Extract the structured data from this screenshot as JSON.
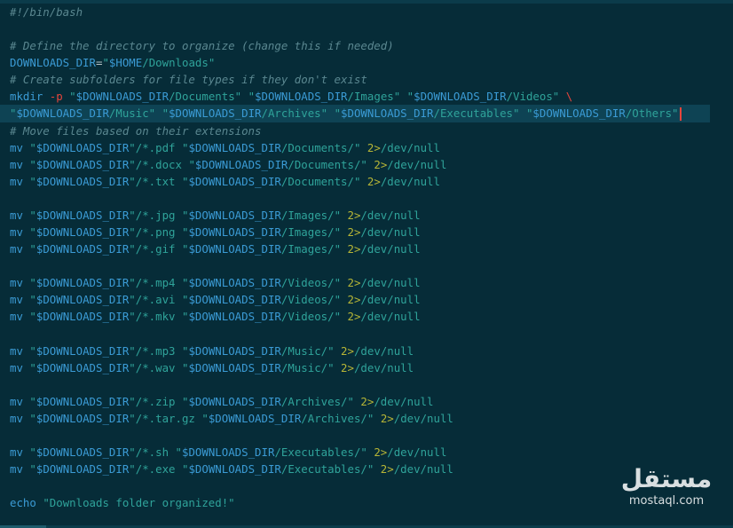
{
  "editor": {
    "lines": [
      {
        "tokens": [
          {
            "t": "comment",
            "v": "#!/bin/bash"
          }
        ]
      },
      {
        "tokens": []
      },
      {
        "tokens": [
          {
            "t": "comment",
            "v": "# Define the directory to organize (change this if needed)"
          }
        ]
      },
      {
        "tokens": [
          {
            "t": "var",
            "v": "DOWNLOADS_DIR"
          },
          {
            "t": "plain",
            "v": "="
          },
          {
            "t": "string",
            "v": "\""
          },
          {
            "t": "var",
            "v": "$HOME"
          },
          {
            "t": "string",
            "v": "/Downloads\""
          }
        ]
      },
      {
        "tokens": [
          {
            "t": "comment",
            "v": "# Create subfolders for file types if they don't exist"
          }
        ]
      },
      {
        "tokens": [
          {
            "t": "cmd",
            "v": "mkdir"
          },
          {
            "t": "plain",
            "v": " "
          },
          {
            "t": "keyword",
            "v": "-p"
          },
          {
            "t": "plain",
            "v": " "
          },
          {
            "t": "string",
            "v": "\""
          },
          {
            "t": "var",
            "v": "$DOWNLOADS_DIR"
          },
          {
            "t": "string",
            "v": "/Documents\""
          },
          {
            "t": "plain",
            "v": " "
          },
          {
            "t": "string",
            "v": "\""
          },
          {
            "t": "var",
            "v": "$DOWNLOADS_DIR"
          },
          {
            "t": "string",
            "v": "/Images\""
          },
          {
            "t": "plain",
            "v": " "
          },
          {
            "t": "string",
            "v": "\""
          },
          {
            "t": "var",
            "v": "$DOWNLOADS_DIR"
          },
          {
            "t": "string",
            "v": "/Videos\""
          },
          {
            "t": "plain",
            "v": " "
          },
          {
            "t": "keyword",
            "v": "\\"
          }
        ]
      },
      {
        "active": true,
        "cursor": true,
        "tokens": [
          {
            "t": "string",
            "v": "\""
          },
          {
            "t": "var",
            "v": "$DOWNLOADS_DIR"
          },
          {
            "t": "string",
            "v": "/Music\""
          },
          {
            "t": "plain",
            "v": " "
          },
          {
            "t": "string",
            "v": "\""
          },
          {
            "t": "var",
            "v": "$DOWNLOADS_DIR"
          },
          {
            "t": "string",
            "v": "/Archives\""
          },
          {
            "t": "plain",
            "v": " "
          },
          {
            "t": "string",
            "v": "\""
          },
          {
            "t": "var",
            "v": "$DOWNLOADS_DIR"
          },
          {
            "t": "string",
            "v": "/Executables\""
          },
          {
            "t": "plain",
            "v": " "
          },
          {
            "t": "string",
            "v": "\""
          },
          {
            "t": "var",
            "v": "$DOWNLOADS_DIR"
          },
          {
            "t": "string",
            "v": "/Others\""
          }
        ]
      },
      {
        "tokens": [
          {
            "t": "comment",
            "v": "# Move files based on their extensions"
          }
        ]
      },
      {
        "tokens": [
          {
            "t": "cmd",
            "v": "mv"
          },
          {
            "t": "plain",
            "v": " "
          },
          {
            "t": "string",
            "v": "\""
          },
          {
            "t": "var",
            "v": "$DOWNLOADS_DIR"
          },
          {
            "t": "string",
            "v": "\"/*.pdf"
          },
          {
            "t": "plain",
            "v": " "
          },
          {
            "t": "string",
            "v": "\""
          },
          {
            "t": "var",
            "v": "$DOWNLOADS_DIR"
          },
          {
            "t": "string",
            "v": "/Documents/\""
          },
          {
            "t": "plain",
            "v": " "
          },
          {
            "t": "redirect",
            "v": "2>"
          },
          {
            "t": "string",
            "v": "/dev/null"
          }
        ]
      },
      {
        "tokens": [
          {
            "t": "cmd",
            "v": "mv"
          },
          {
            "t": "plain",
            "v": " "
          },
          {
            "t": "string",
            "v": "\""
          },
          {
            "t": "var",
            "v": "$DOWNLOADS_DIR"
          },
          {
            "t": "string",
            "v": "\"/*.docx"
          },
          {
            "t": "plain",
            "v": " "
          },
          {
            "t": "string",
            "v": "\""
          },
          {
            "t": "var",
            "v": "$DOWNLOADS_DIR"
          },
          {
            "t": "string",
            "v": "/Documents/\""
          },
          {
            "t": "plain",
            "v": " "
          },
          {
            "t": "redirect",
            "v": "2>"
          },
          {
            "t": "string",
            "v": "/dev/null"
          }
        ]
      },
      {
        "tokens": [
          {
            "t": "cmd",
            "v": "mv"
          },
          {
            "t": "plain",
            "v": " "
          },
          {
            "t": "string",
            "v": "\""
          },
          {
            "t": "var",
            "v": "$DOWNLOADS_DIR"
          },
          {
            "t": "string",
            "v": "\"/*.txt"
          },
          {
            "t": "plain",
            "v": " "
          },
          {
            "t": "string",
            "v": "\""
          },
          {
            "t": "var",
            "v": "$DOWNLOADS_DIR"
          },
          {
            "t": "string",
            "v": "/Documents/\""
          },
          {
            "t": "plain",
            "v": " "
          },
          {
            "t": "redirect",
            "v": "2>"
          },
          {
            "t": "string",
            "v": "/dev/null"
          }
        ]
      },
      {
        "tokens": []
      },
      {
        "tokens": [
          {
            "t": "cmd",
            "v": "mv"
          },
          {
            "t": "plain",
            "v": " "
          },
          {
            "t": "string",
            "v": "\""
          },
          {
            "t": "var",
            "v": "$DOWNLOADS_DIR"
          },
          {
            "t": "string",
            "v": "\"/*.jpg"
          },
          {
            "t": "plain",
            "v": " "
          },
          {
            "t": "string",
            "v": "\""
          },
          {
            "t": "var",
            "v": "$DOWNLOADS_DIR"
          },
          {
            "t": "string",
            "v": "/Images/\""
          },
          {
            "t": "plain",
            "v": " "
          },
          {
            "t": "redirect",
            "v": "2>"
          },
          {
            "t": "string",
            "v": "/dev/null"
          }
        ]
      },
      {
        "tokens": [
          {
            "t": "cmd",
            "v": "mv"
          },
          {
            "t": "plain",
            "v": " "
          },
          {
            "t": "string",
            "v": "\""
          },
          {
            "t": "var",
            "v": "$DOWNLOADS_DIR"
          },
          {
            "t": "string",
            "v": "\"/*.png"
          },
          {
            "t": "plain",
            "v": " "
          },
          {
            "t": "string",
            "v": "\""
          },
          {
            "t": "var",
            "v": "$DOWNLOADS_DIR"
          },
          {
            "t": "string",
            "v": "/Images/\""
          },
          {
            "t": "plain",
            "v": " "
          },
          {
            "t": "redirect",
            "v": "2>"
          },
          {
            "t": "string",
            "v": "/dev/null"
          }
        ]
      },
      {
        "tokens": [
          {
            "t": "cmd",
            "v": "mv"
          },
          {
            "t": "plain",
            "v": " "
          },
          {
            "t": "string",
            "v": "\""
          },
          {
            "t": "var",
            "v": "$DOWNLOADS_DIR"
          },
          {
            "t": "string",
            "v": "\"/*.gif"
          },
          {
            "t": "plain",
            "v": " "
          },
          {
            "t": "string",
            "v": "\""
          },
          {
            "t": "var",
            "v": "$DOWNLOADS_DIR"
          },
          {
            "t": "string",
            "v": "/Images/\""
          },
          {
            "t": "plain",
            "v": " "
          },
          {
            "t": "redirect",
            "v": "2>"
          },
          {
            "t": "string",
            "v": "/dev/null"
          }
        ]
      },
      {
        "tokens": []
      },
      {
        "tokens": [
          {
            "t": "cmd",
            "v": "mv"
          },
          {
            "t": "plain",
            "v": " "
          },
          {
            "t": "string",
            "v": "\""
          },
          {
            "t": "var",
            "v": "$DOWNLOADS_DIR"
          },
          {
            "t": "string",
            "v": "\"/*.mp4"
          },
          {
            "t": "plain",
            "v": " "
          },
          {
            "t": "string",
            "v": "\""
          },
          {
            "t": "var",
            "v": "$DOWNLOADS_DIR"
          },
          {
            "t": "string",
            "v": "/Videos/\""
          },
          {
            "t": "plain",
            "v": " "
          },
          {
            "t": "redirect",
            "v": "2>"
          },
          {
            "t": "string",
            "v": "/dev/null"
          }
        ]
      },
      {
        "tokens": [
          {
            "t": "cmd",
            "v": "mv"
          },
          {
            "t": "plain",
            "v": " "
          },
          {
            "t": "string",
            "v": "\""
          },
          {
            "t": "var",
            "v": "$DOWNLOADS_DIR"
          },
          {
            "t": "string",
            "v": "\"/*.avi"
          },
          {
            "t": "plain",
            "v": " "
          },
          {
            "t": "string",
            "v": "\""
          },
          {
            "t": "var",
            "v": "$DOWNLOADS_DIR"
          },
          {
            "t": "string",
            "v": "/Videos/\""
          },
          {
            "t": "plain",
            "v": " "
          },
          {
            "t": "redirect",
            "v": "2>"
          },
          {
            "t": "string",
            "v": "/dev/null"
          }
        ]
      },
      {
        "tokens": [
          {
            "t": "cmd",
            "v": "mv"
          },
          {
            "t": "plain",
            "v": " "
          },
          {
            "t": "string",
            "v": "\""
          },
          {
            "t": "var",
            "v": "$DOWNLOADS_DIR"
          },
          {
            "t": "string",
            "v": "\"/*.mkv"
          },
          {
            "t": "plain",
            "v": " "
          },
          {
            "t": "string",
            "v": "\""
          },
          {
            "t": "var",
            "v": "$DOWNLOADS_DIR"
          },
          {
            "t": "string",
            "v": "/Videos/\""
          },
          {
            "t": "plain",
            "v": " "
          },
          {
            "t": "redirect",
            "v": "2>"
          },
          {
            "t": "string",
            "v": "/dev/null"
          }
        ]
      },
      {
        "tokens": []
      },
      {
        "tokens": [
          {
            "t": "cmd",
            "v": "mv"
          },
          {
            "t": "plain",
            "v": " "
          },
          {
            "t": "string",
            "v": "\""
          },
          {
            "t": "var",
            "v": "$DOWNLOADS_DIR"
          },
          {
            "t": "string",
            "v": "\"/*.mp3"
          },
          {
            "t": "plain",
            "v": " "
          },
          {
            "t": "string",
            "v": "\""
          },
          {
            "t": "var",
            "v": "$DOWNLOADS_DIR"
          },
          {
            "t": "string",
            "v": "/Music/\""
          },
          {
            "t": "plain",
            "v": " "
          },
          {
            "t": "redirect",
            "v": "2>"
          },
          {
            "t": "string",
            "v": "/dev/null"
          }
        ]
      },
      {
        "tokens": [
          {
            "t": "cmd",
            "v": "mv"
          },
          {
            "t": "plain",
            "v": " "
          },
          {
            "t": "string",
            "v": "\""
          },
          {
            "t": "var",
            "v": "$DOWNLOADS_DIR"
          },
          {
            "t": "string",
            "v": "\"/*.wav"
          },
          {
            "t": "plain",
            "v": " "
          },
          {
            "t": "string",
            "v": "\""
          },
          {
            "t": "var",
            "v": "$DOWNLOADS_DIR"
          },
          {
            "t": "string",
            "v": "/Music/\""
          },
          {
            "t": "plain",
            "v": " "
          },
          {
            "t": "redirect",
            "v": "2>"
          },
          {
            "t": "string",
            "v": "/dev/null"
          }
        ]
      },
      {
        "tokens": []
      },
      {
        "tokens": [
          {
            "t": "cmd",
            "v": "mv"
          },
          {
            "t": "plain",
            "v": " "
          },
          {
            "t": "string",
            "v": "\""
          },
          {
            "t": "var",
            "v": "$DOWNLOADS_DIR"
          },
          {
            "t": "string",
            "v": "\"/*.zip"
          },
          {
            "t": "plain",
            "v": " "
          },
          {
            "t": "string",
            "v": "\""
          },
          {
            "t": "var",
            "v": "$DOWNLOADS_DIR"
          },
          {
            "t": "string",
            "v": "/Archives/\""
          },
          {
            "t": "plain",
            "v": " "
          },
          {
            "t": "redirect",
            "v": "2>"
          },
          {
            "t": "string",
            "v": "/dev/null"
          }
        ]
      },
      {
        "tokens": [
          {
            "t": "cmd",
            "v": "mv"
          },
          {
            "t": "plain",
            "v": " "
          },
          {
            "t": "string",
            "v": "\""
          },
          {
            "t": "var",
            "v": "$DOWNLOADS_DIR"
          },
          {
            "t": "string",
            "v": "\"/*.tar.gz"
          },
          {
            "t": "plain",
            "v": " "
          },
          {
            "t": "string",
            "v": "\""
          },
          {
            "t": "var",
            "v": "$DOWNLOADS_DIR"
          },
          {
            "t": "string",
            "v": "/Archives/\""
          },
          {
            "t": "plain",
            "v": " "
          },
          {
            "t": "redirect",
            "v": "2>"
          },
          {
            "t": "string",
            "v": "/dev/null"
          }
        ]
      },
      {
        "tokens": []
      },
      {
        "tokens": [
          {
            "t": "cmd",
            "v": "mv"
          },
          {
            "t": "plain",
            "v": " "
          },
          {
            "t": "string",
            "v": "\""
          },
          {
            "t": "var",
            "v": "$DOWNLOADS_DIR"
          },
          {
            "t": "string",
            "v": "\"/*.sh"
          },
          {
            "t": "plain",
            "v": " "
          },
          {
            "t": "string",
            "v": "\""
          },
          {
            "t": "var",
            "v": "$DOWNLOADS_DIR"
          },
          {
            "t": "string",
            "v": "/Executables/\""
          },
          {
            "t": "plain",
            "v": " "
          },
          {
            "t": "redirect",
            "v": "2>"
          },
          {
            "t": "string",
            "v": "/dev/null"
          }
        ]
      },
      {
        "tokens": [
          {
            "t": "cmd",
            "v": "mv"
          },
          {
            "t": "plain",
            "v": " "
          },
          {
            "t": "string",
            "v": "\""
          },
          {
            "t": "var",
            "v": "$DOWNLOADS_DIR"
          },
          {
            "t": "string",
            "v": "\"/*.exe"
          },
          {
            "t": "plain",
            "v": " "
          },
          {
            "t": "string",
            "v": "\""
          },
          {
            "t": "var",
            "v": "$DOWNLOADS_DIR"
          },
          {
            "t": "string",
            "v": "/Executables/\""
          },
          {
            "t": "plain",
            "v": " "
          },
          {
            "t": "redirect",
            "v": "2>"
          },
          {
            "t": "string",
            "v": "/dev/null"
          }
        ]
      },
      {
        "tokens": []
      },
      {
        "tokens": [
          {
            "t": "cmd",
            "v": "echo"
          },
          {
            "t": "plain",
            "v": " "
          },
          {
            "t": "string",
            "v": "\"Downloads folder organized!\""
          }
        ]
      }
    ]
  },
  "watermark": {
    "logo_text": "مستقل",
    "url_text": "mostaql.com"
  },
  "colors": {
    "background": "#062c38",
    "comment": "#5a8790",
    "variable": "#3b9bd5",
    "string": "#2fa39a",
    "keyword": "#e8453c",
    "redirect": "#b6b536",
    "active_line": "#0e4354"
  }
}
